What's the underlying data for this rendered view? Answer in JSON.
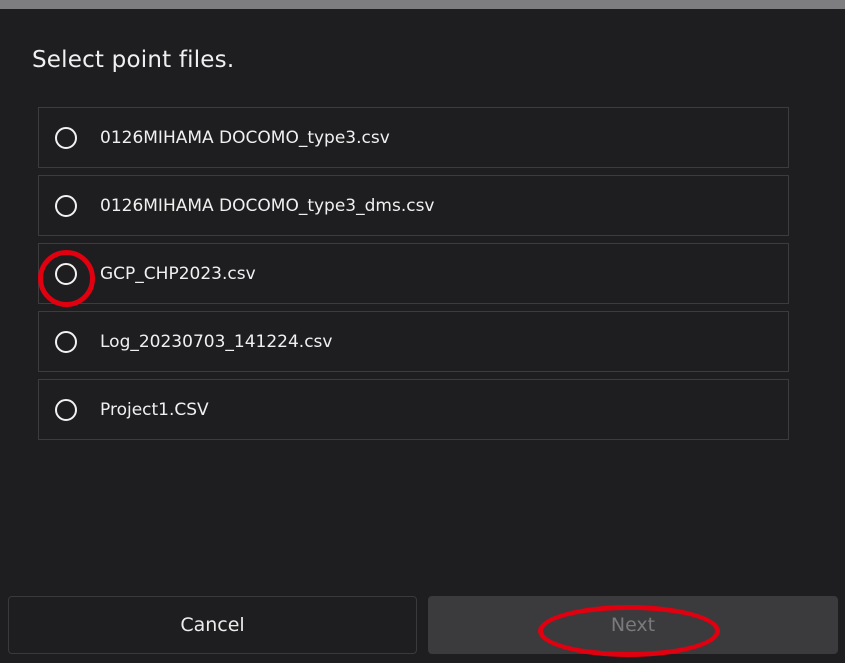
{
  "dialog": {
    "title": "Select point files."
  },
  "files": [
    {
      "name": "0126MIHAMA DOCOMO_type3.csv",
      "selected": false
    },
    {
      "name": "0126MIHAMA DOCOMO_type3_dms.csv",
      "selected": false
    },
    {
      "name": "GCP_CHP2023.csv",
      "selected": false
    },
    {
      "name": "Log_20230703_141224.csv",
      "selected": false
    },
    {
      "name": "Project1.CSV",
      "selected": false
    }
  ],
  "buttons": {
    "cancel_label": "Cancel",
    "next_label": "Next",
    "next_enabled": false
  },
  "annotations": {
    "highlight_color": "#e00010"
  },
  "colors": {
    "background": "#1e1e20",
    "border": "#3c3c3e",
    "text": "#f0f0f0",
    "disabled_button_bg": "#3b3b3d",
    "disabled_text": "#7a7a7c"
  },
  "icons": {
    "radio": "radio-unchecked-icon"
  }
}
